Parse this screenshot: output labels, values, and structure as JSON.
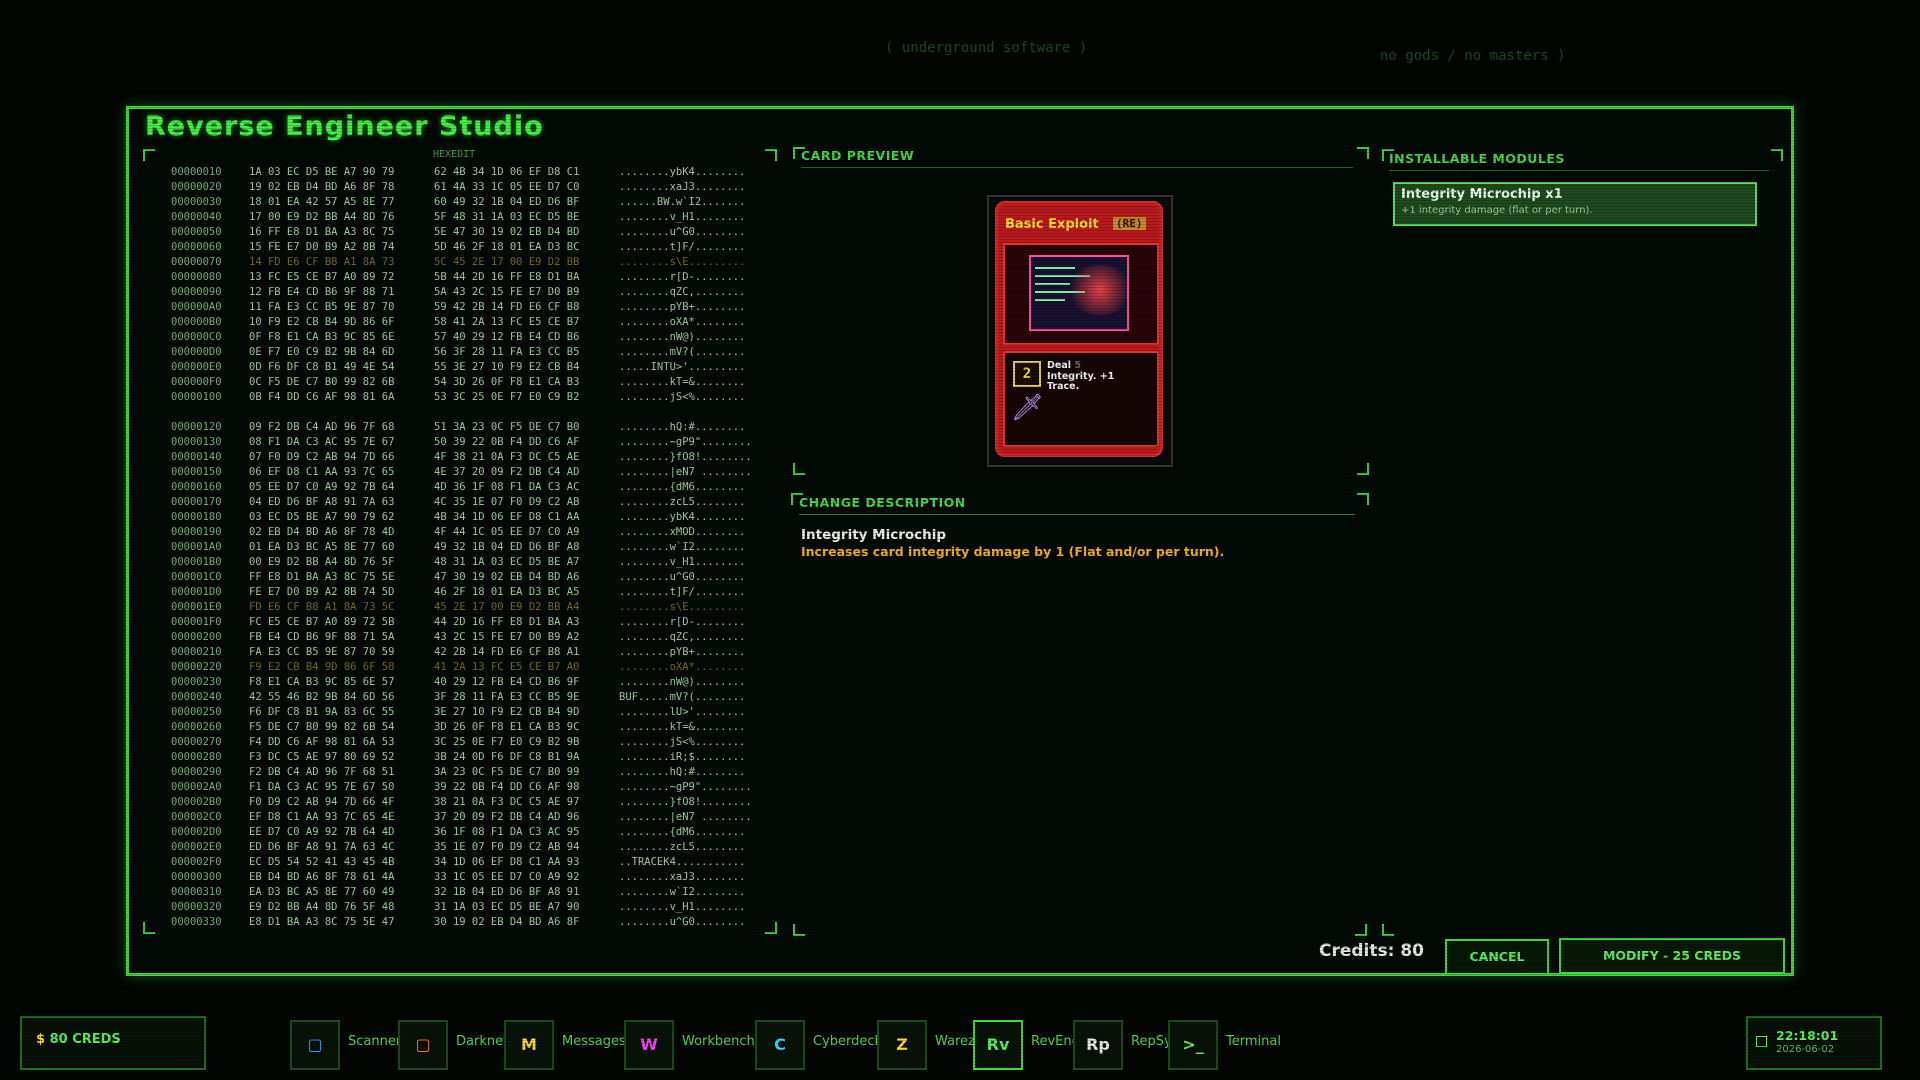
{
  "window": {
    "title": "Reverse Engineer Studio"
  },
  "background": {
    "tag_left": "( underground software )",
    "tag_right": "no gods / no masters )"
  },
  "hex": {
    "label": "HEXEDIT",
    "rows": [
      [
        "00000010",
        "1A 03 EC D5 BE A7 90 79",
        "62 4B 34 1D 06 EF D8 C1",
        "........ybK4........",
        false
      ],
      [
        "00000020",
        "19 02 EB D4 BD A6 8F 78",
        "61 4A 33 1C 05 EE D7 C0",
        "........xaJ3........",
        false
      ],
      [
        "00000030",
        "18 01 EA 42 57 A5 8E 77",
        "60 49 32 1B 04 ED D6 BF",
        "......BW.w`I2.......",
        false
      ],
      [
        "00000040",
        "17 00 E9 D2 BB A4 8D 76",
        "5F 48 31 1A 03 EC D5 BE",
        "........v_H1........",
        false
      ],
      [
        "00000050",
        "16 FF E8 D1 BA A3 8C 75",
        "5E 47 30 19 02 EB D4 BD",
        "........u^G0........",
        false
      ],
      [
        "00000060",
        "15 FE E7 D0 B9 A2 8B 74",
        "5D 46 2F 18 01 EA D3 BC",
        "........t]F/........",
        false
      ],
      [
        "00000070",
        "14 FD E6 CF B8 A1 8A 73",
        "5C 45 2E 17 00 E9 D2 BB",
        "........s\\E.........",
        true
      ],
      [
        "00000080",
        "13 FC E5 CE B7 A0 89 72",
        "5B 44 2D 16 FF E8 D1 BA",
        "........r[D-........",
        false
      ],
      [
        "00000090",
        "12 FB E4 CD B6 9F 88 71",
        "5A 43 2C 15 FE E7 D0 B9",
        "........qZC,........",
        false
      ],
      [
        "000000A0",
        "11 FA E3 CC B5 9E 87 70",
        "59 42 2B 14 FD E6 CF B8",
        "........pYB+........",
        false
      ],
      [
        "000000B0",
        "10 F9 E2 CB B4 9D 86 6F",
        "58 41 2A 13 FC E5 CE B7",
        "........oXA*........",
        false
      ],
      [
        "000000C0",
        "0F F8 E1 CA B3 9C 85 6E",
        "57 40 29 12 FB E4 CD B6",
        "........nW@)........",
        false
      ],
      [
        "000000D0",
        "0E F7 E0 C9 B2 9B 84 6D",
        "56 3F 28 11 FA E3 CC B5",
        "........mV?(........",
        false
      ],
      [
        "000000E0",
        "0D F6 DF C8 B1 49 4E 54",
        "55 3E 27 10 F9 E2 CB B4",
        ".....INTU>'.........",
        false
      ],
      [
        "000000F0",
        "0C F5 DE C7 B0 99 82 6B",
        "54 3D 26 0F F8 E1 CA B3",
        "........kT=&........",
        false
      ],
      [
        "00000100",
        "0B F4 DD C6 AF 98 81 6A",
        "53 3C 25 0E F7 E0 C9 B2",
        "........jS<%........",
        false
      ],
      [
        "",
        "",
        "",
        "",
        false
      ],
      [
        "00000120",
        "09 F2 DB C4 AD 96 7F 68",
        "51 3A 23 0C F5 DE C7 B0",
        "........hQ:#........",
        false
      ],
      [
        "00000130",
        "08 F1 DA C3 AC 95 7E 67",
        "50 39 22 0B F4 DD C6 AF",
        "........~gP9\"........",
        false
      ],
      [
        "00000140",
        "07 F0 D9 C2 AB 94 7D 66",
        "4F 38 21 0A F3 DC C5 AE",
        "........}fO8!........",
        false
      ],
      [
        "00000150",
        "06 EF D8 C1 AA 93 7C 65",
        "4E 37 20 09 F2 DB C4 AD",
        "........|eN7 ........",
        false
      ],
      [
        "00000160",
        "05 EE D7 C0 A9 92 7B 64",
        "4D 36 1F 08 F1 DA C3 AC",
        "........{dM6........",
        false
      ],
      [
        "00000170",
        "04 ED D6 BF A8 91 7A 63",
        "4C 35 1E 07 F0 D9 C2 AB",
        "........zcL5........",
        false
      ],
      [
        "00000180",
        "03 EC D5 BE A7 90 79 62",
        "4B 34 1D 06 EF D8 C1 AA",
        "........ybK4........",
        false
      ],
      [
        "00000190",
        "02 EB D4 BD A6 8F 78 4D",
        "4F 44 1C 05 EE D7 C0 A9",
        "........xMOD........",
        false
      ],
      [
        "000001A0",
        "01 EA D3 BC A5 8E 77 60",
        "49 32 1B 04 ED D6 BF A8",
        "........w`I2........",
        false
      ],
      [
        "000001B0",
        "00 E9 D2 BB A4 8D 76 5F",
        "48 31 1A 03 EC D5 BE A7",
        "........v_H1........",
        false
      ],
      [
        "000001C0",
        "FF E8 D1 BA A3 8C 75 5E",
        "47 30 19 02 EB D4 BD A6",
        "........u^G0........",
        false
      ],
      [
        "000001D0",
        "FE E7 D0 B9 A2 8B 74 5D",
        "46 2F 18 01 EA D3 BC A5",
        "........t]F/........",
        false
      ],
      [
        "000001E0",
        "FD E6 CF B8 A1 8A 73 5C",
        "45 2E 17 00 E9 D2 BB A4",
        "........s\\E.........",
        true
      ],
      [
        "000001F0",
        "FC E5 CE B7 A0 89 72 5B",
        "44 2D 16 FF E8 D1 BA A3",
        "........r[D-........",
        false
      ],
      [
        "00000200",
        "FB E4 CD B6 9F 88 71 5A",
        "43 2C 15 FE E7 D0 B9 A2",
        "........qZC,........",
        false
      ],
      [
        "00000210",
        "FA E3 CC B5 9E 87 70 59",
        "42 2B 14 FD E6 CF B8 A1",
        "........pYB+........",
        false
      ],
      [
        "00000220",
        "F9 E2 CB B4 9D 86 6F 58",
        "41 2A 13 FC E5 CE B7 A0",
        "........oXA*........",
        true
      ],
      [
        "00000230",
        "F8 E1 CA B3 9C 85 6E 57",
        "40 29 12 FB E4 CD B6 9F",
        "........nW@)........",
        false
      ],
      [
        "00000240",
        "42 55 46 B2 9B 84 6D 56",
        "3F 28 11 FA E3 CC B5 9E",
        "BUF.....mV?(........",
        false
      ],
      [
        "00000250",
        "F6 DF C8 B1 9A 83 6C 55",
        "3E 27 10 F9 E2 CB B4 9D",
        "........lU>'........",
        false
      ],
      [
        "00000260",
        "F5 DE C7 B0 99 82 6B 54",
        "3D 26 0F F8 E1 CA B3 9C",
        "........kT=&........",
        false
      ],
      [
        "00000270",
        "F4 DD C6 AF 98 81 6A 53",
        "3C 25 0E F7 E0 C9 B2 9B",
        "........jS<%........",
        false
      ],
      [
        "00000280",
        "F3 DC C5 AE 97 80 69 52",
        "3B 24 0D F6 DF C8 B1 9A",
        "........iR;$........",
        false
      ],
      [
        "00000290",
        "F2 DB C4 AD 96 7F 68 51",
        "3A 23 0C F5 DE C7 B0 99",
        "........hQ:#........",
        false
      ],
      [
        "000002A0",
        "F1 DA C3 AC 95 7E 67 50",
        "39 22 0B F4 DD C6 AF 98",
        "........~gP9\"........",
        false
      ],
      [
        "000002B0",
        "F0 D9 C2 AB 94 7D 66 4F",
        "38 21 0A F3 DC C5 AE 97",
        "........}fO8!........",
        false
      ],
      [
        "000002C0",
        "EF D8 C1 AA 93 7C 65 4E",
        "37 20 09 F2 DB C4 AD 96",
        "........|eN7 ........",
        false
      ],
      [
        "000002D0",
        "EE D7 C0 A9 92 7B 64 4D",
        "36 1F 08 F1 DA C3 AC 95",
        "........{dM6........",
        false
      ],
      [
        "000002E0",
        "ED D6 BF A8 91 7A 63 4C",
        "35 1E 07 F0 D9 C2 AB 94",
        "........zcL5........",
        false
      ],
      [
        "000002F0",
        "EC D5 54 52 41 43 45 4B",
        "34 1D 06 EF D8 C1 AA 93",
        "..TRACEK4...........",
        false
      ],
      [
        "00000300",
        "EB D4 BD A6 8F 78 61 4A",
        "33 1C 05 EE D7 C0 A9 92",
        "........xaJ3........",
        false
      ],
      [
        "00000310",
        "EA D3 BC A5 8E 77 60 49",
        "32 1B 04 ED D6 BF A8 91",
        "........w`I2........",
        false
      ],
      [
        "00000320",
        "E9 D2 BB A4 8D 76 5F 48",
        "31 1A 03 EC D5 BE A7 90",
        "........v_H1........",
        false
      ],
      [
        "00000330",
        "E8 D1 BA A3 8C 75 5E 47",
        "30 19 02 EB D4 BD A6 8F",
        "........u^G0........",
        false
      ]
    ]
  },
  "card_preview": {
    "title": "CARD PREVIEW",
    "card": {
      "name": "Basic Exploit",
      "tag": "(RE)",
      "cost": "2",
      "desc_line1": "Deal",
      "desc_faded": "5",
      "desc_line2": "Integrity. +1",
      "desc_line3": "Trace.",
      "art_icon": "terminal-screen"
    }
  },
  "change": {
    "title": "CHANGE DESCRIPTION",
    "module_name": "Integrity Microchip",
    "description": "Increases card integrity damage by 1 (Flat and/or per turn)."
  },
  "modules": {
    "title": "INSTALLABLE MODULES",
    "items": [
      {
        "name": "Integrity Microchip  x1",
        "desc": "+1 integrity damage (flat or per turn)."
      }
    ]
  },
  "footer": {
    "credits_label": "Credits: 80",
    "cancel": "CANCEL",
    "modify": "MODIFY - 25 CREDS"
  },
  "taskbar": {
    "creds_symbol": "$",
    "creds": "80 CREDS",
    "items": [
      {
        "icon": "▢",
        "label": "Scanner",
        "color": "#39a9ff"
      },
      {
        "icon": "▢",
        "label": "Darknet",
        "color": "#ff8a2a"
      },
      {
        "icon": "M",
        "label": "Messages",
        "color": "#ffd633"
      },
      {
        "icon": "W",
        "label": "Workbench",
        "color": "#ff3dff"
      },
      {
        "icon": "C",
        "label": "Cyberdeck",
        "color": "#3dd8ff"
      },
      {
        "icon": "Z",
        "label": "Warez",
        "color": "#ffd633"
      },
      {
        "icon": "Rv",
        "label": "RevEng",
        "color": "#5cf05c"
      },
      {
        "icon": "Rp",
        "label": "RepSys",
        "color": "#e8e8e8"
      },
      {
        "icon": ">_",
        "label": "Terminal",
        "color": "#5cf05c"
      }
    ],
    "clock_time": "22:18:01",
    "clock_date": "2026-06-02"
  },
  "colors": {
    "accent": "#3ed83e",
    "warning": "#f2b21f",
    "card_red": "#b8191c"
  }
}
